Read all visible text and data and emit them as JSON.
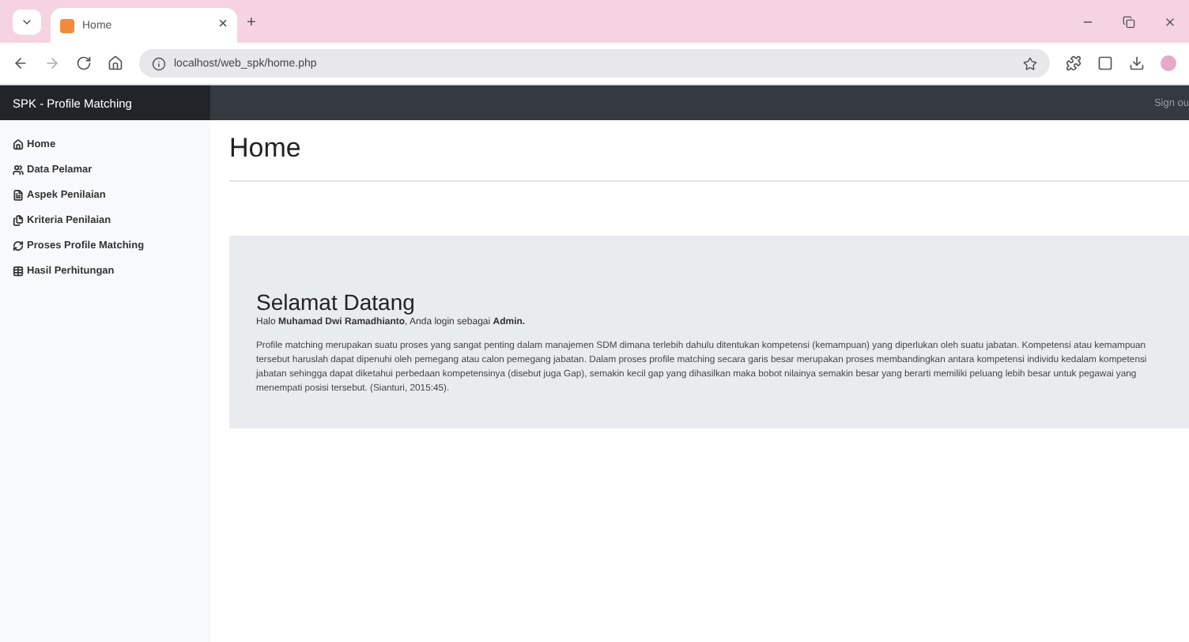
{
  "browser": {
    "tab_title": "Home",
    "tab_close": "×",
    "new_tab": "+",
    "url": "localhost/web_spk/home.php"
  },
  "navbar": {
    "brand": "SPK - Profile Matching",
    "sign_out": "Sign ou"
  },
  "sidebar": {
    "items": [
      {
        "label": "Home"
      },
      {
        "label": "Data Pelamar"
      },
      {
        "label": "Aspek Penilaian"
      },
      {
        "label": "Kriteria Penilaian"
      },
      {
        "label": "Proses Profile Matching"
      },
      {
        "label": "Hasil Perhitungan"
      }
    ]
  },
  "page_title": "Home",
  "welcome": {
    "title": "Selamat Datang",
    "greeting": "Halo **Muhamad Dwi Ramadhianto**, Anda login sebagai **Admin.**",
    "paragraph": "Profile matching merupakan suatu proses yang sangat penting dalam manajemen SDM dimana terlebih dahulu ditentukan kompetensi (kemampuan) yang diperlukan oleh suatu jabatan. Kompetensi atau kemampuan tersebut haruslah dapat dipenuhi oleh pemegang atau calon pemegang jabatan. Dalam proses profile matching secara garis besar merupakan proses membandingkan antara kompetensi individu kedalam kompetensi jabatan sehingga dapat diketahui perbedaan kompetensinya (disebut juga Gap), semakin kecil gap yang dihasilkan maka bobot nilainya semakin besar yang berarti memiliki peluang lebih besar untuk pegawai yang menempati posisi tersebut. (Sianturi, 2015:45)."
  }
}
